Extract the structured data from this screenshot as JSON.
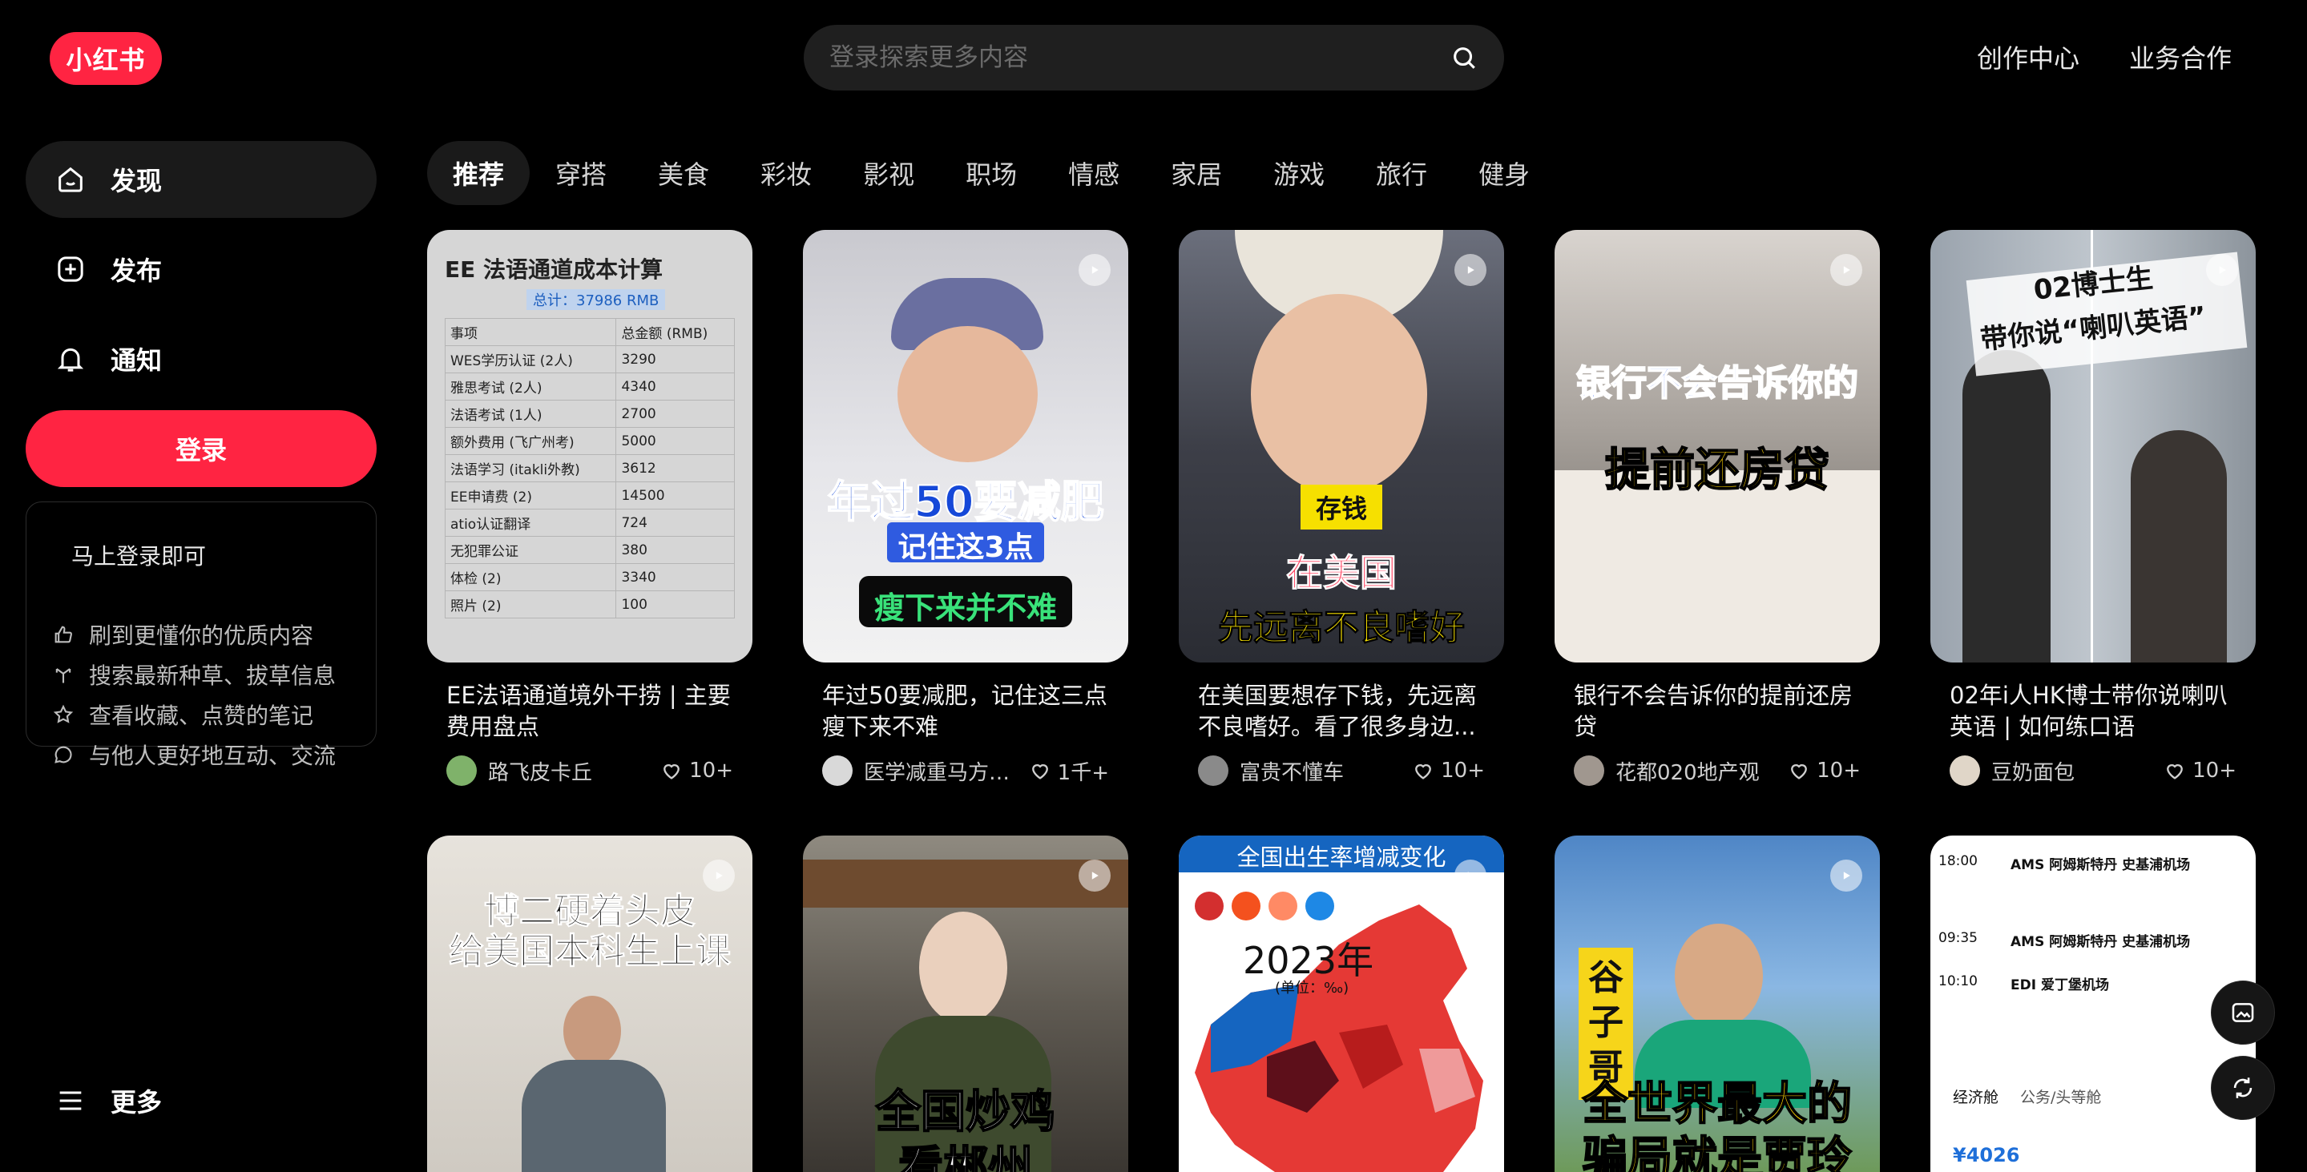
{
  "logo": {
    "text": "小红书"
  },
  "search": {
    "placeholder": "登录探索更多内容"
  },
  "header": {
    "links": [
      "创作中心",
      "业务合作"
    ]
  },
  "sidebar": {
    "items": [
      {
        "label": "发现",
        "icon": "house-icon",
        "active": true
      },
      {
        "label": "发布",
        "icon": "plus-square-icon"
      },
      {
        "label": "通知",
        "icon": "bell-icon"
      }
    ],
    "login_label": "登录",
    "login_card": {
      "title": "马上登录即可",
      "rows": [
        {
          "icon": "thumb-up-icon",
          "text": "刷到更懂你的优质内容"
        },
        {
          "icon": "branch-icon",
          "text": "搜索最新种草、拔草信息"
        },
        {
          "icon": "star-icon",
          "text": "查看收藏、点赞的笔记"
        },
        {
          "icon": "chat-icon",
          "text": "与他人更好地互动、交流"
        }
      ]
    },
    "more_label": "更多"
  },
  "tabs": [
    "推荐",
    "穿搭",
    "美食",
    "彩妆",
    "影视",
    "职场",
    "情感",
    "家居",
    "游戏",
    "旅行",
    "健身"
  ],
  "cards": [
    {
      "title": "EE法语通道境外干捞 | 主要费用盘点",
      "author": "路飞皮卡丘",
      "likes": "10+",
      "thumb": {
        "title": "EE 法语通道成本计算",
        "total": "总计：37986 RMB",
        "header": [
          "事项",
          "总金额 (RMB)"
        ],
        "rows": [
          [
            "WES学历认证 (2人)",
            "3290"
          ],
          [
            "雅思考试 (2人)",
            "4340"
          ],
          [
            "法语考试 (1人)",
            "2700"
          ],
          [
            "额外费用 (飞广州考)",
            "5000"
          ],
          [
            "法语学习 (itakli外教)",
            "3612"
          ],
          [
            "EE申请费 (2)",
            "14500"
          ],
          [
            "atio认证翻译",
            "724"
          ],
          [
            "无犯罪公证",
            "380"
          ],
          [
            "体检 (2)",
            "3340"
          ],
          [
            "照片 (2)",
            "100"
          ]
        ]
      }
    },
    {
      "title": "年过50要减肥，记住这三点瘦下来不难",
      "author": "医学减重马方教...",
      "likes": "1千+",
      "thumb": {
        "lines": [
          "年过50要减肥",
          "记住这3点",
          "瘦下来并不难"
        ]
      }
    },
    {
      "title": "在美国要想存下钱，先远离不良嗜好。看了很多身边...",
      "author": "富贵不懂车",
      "likes": "10+",
      "thumb": {
        "lines": [
          "存钱",
          "在美国",
          "先远离不良嗜好"
        ]
      }
    },
    {
      "title": "银行不会告诉你的提前还房贷",
      "author": "花都020地产观",
      "likes": "10+",
      "thumb": {
        "lines": [
          "银行不会告诉你的",
          "提前还房贷"
        ]
      }
    },
    {
      "title": "02年i人HK博士带你说喇叭英语 | 如何练口语",
      "author": "豆奶面包",
      "likes": "10+",
      "thumb": {
        "lines": [
          "02博士生",
          "带你说“喇叭英语”"
        ]
      }
    },
    {
      "thumb": {
        "lines": [
          "博二硬着头皮",
          "给美国本科生上课"
        ]
      }
    },
    {
      "thumb": {
        "lines": [
          "全国炒鸡",
          "看郴州"
        ]
      }
    },
    {
      "thumb": {
        "lines": [
          "全国出生率增减变化",
          "2023年",
          "(单位：‰)"
        ]
      }
    },
    {
      "thumb": {
        "lines": [
          "谷子哥",
          "全世界最大的",
          "骗局就是贾玲"
        ]
      }
    },
    {
      "thumb": {
        "lines": [
          "18:00",
          "AMS 阿姆斯特丹 史基浦机场",
          "09:35",
          "AMS 阿姆斯特丹 史基浦机场",
          "10:10",
          "EDI 爱丁堡机场",
          "经济舱",
          "公务/头等舱",
          "¥4026"
        ]
      }
    }
  ],
  "colors": {
    "brand": "#ff2442",
    "background": "#000000",
    "surface": "#1a1a1a"
  }
}
